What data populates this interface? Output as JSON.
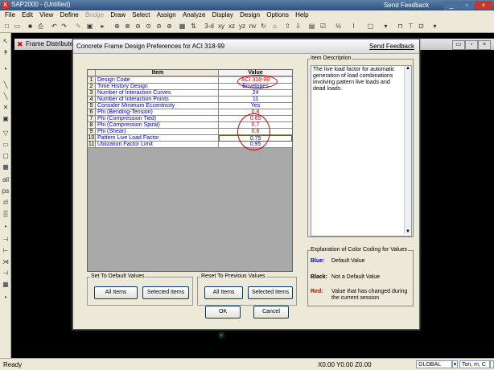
{
  "app": {
    "title": "SAP2000 - (Untitled)",
    "app_icon": "X",
    "send_feedback": "Send Feedback",
    "window_buttons": [
      "_",
      "▫",
      "×"
    ]
  },
  "menu": [
    "File",
    "Edit",
    "View",
    "Define",
    "Bridge",
    "Draw",
    "Select",
    "Assign",
    "Analyze",
    "Display",
    "Design",
    "Options",
    "Help"
  ],
  "toolbar": {
    "view_3d": "3-d",
    "view_xy": "xy",
    "view_xz": "xz",
    "view_yz": "yz",
    "view_nv": "nv"
  },
  "mdi": {
    "title": "Frame Distributed",
    "buttons": [
      "▭",
      "▫",
      "×"
    ]
  },
  "dialog": {
    "title": "Concrete Frame Design Preferences for ACI 318-99",
    "send_feedback": "Send Feedback",
    "table": {
      "header_item": "Item",
      "header_value": "Value",
      "rows": [
        {
          "num": "1",
          "item": "Design Code",
          "value": "ACI 318-99",
          "color": "red"
        },
        {
          "num": "2",
          "item": "Time History Design",
          "value": "Envelopes",
          "color": "blue"
        },
        {
          "num": "3",
          "item": "Number of Interaction Curves",
          "value": "24",
          "color": "blue"
        },
        {
          "num": "4",
          "item": "Number of Interaction Points",
          "value": "11",
          "color": "blue"
        },
        {
          "num": "5",
          "item": "Consider Minimum Eccentricity",
          "value": "Yes",
          "color": "blue"
        },
        {
          "num": "6",
          "item": "Phi (Bending-Tension)",
          "value": "0.8",
          "color": "red"
        },
        {
          "num": "7",
          "item": "Phi (Compression Tied)",
          "value": "0.65",
          "color": "red"
        },
        {
          "num": "8",
          "item": "Phi (Compression Spiral)",
          "value": "0.7",
          "color": "red"
        },
        {
          "num": "9",
          "item": "Phi (Shear)",
          "value": "0.6",
          "color": "red"
        },
        {
          "num": "10",
          "item": "Pattern Live Load Factor",
          "value": "0.75",
          "color": "blue"
        },
        {
          "num": "11",
          "item": "Utilization Factor Limit",
          "value": "0.95",
          "color": "blue"
        }
      ]
    },
    "description": {
      "label": "Item Description",
      "text": "The live load factor for automatic generation of load combinations involving pattern live loads and dead loads."
    },
    "legend": {
      "label": "Explanation of Color Coding for Values",
      "blue_key": "Blue:",
      "blue_text": "Default Value",
      "black_key": "Black:",
      "black_text": "Not a Default Value",
      "red_key": "Red:",
      "red_text": "Value that has changed during the current session",
      "colors": {
        "blue": "#0000c8",
        "black": "#000000",
        "red": "#d00000"
      }
    },
    "set_default": {
      "label": "Set To Default Values",
      "all_items": "All Items",
      "selected_items": "Selected Items"
    },
    "reset_previous": {
      "label": "Reset To Previous Values",
      "all_items": "All Items",
      "selected_items": "Selected Items"
    },
    "ok": "OK",
    "cancel": "Cancel"
  },
  "status": {
    "left": "Ready",
    "coords": "X0.00  Y0.00  Z0.00",
    "coord_system": "GLOBAL",
    "units": "Ton, m, C"
  }
}
